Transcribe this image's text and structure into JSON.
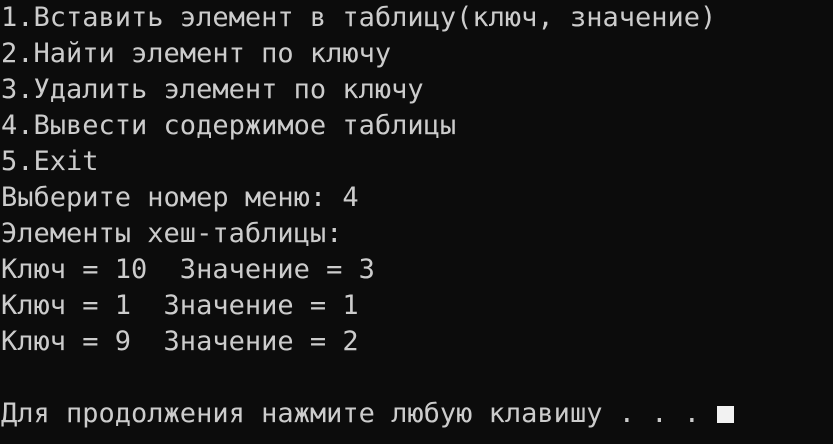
{
  "console": {
    "lines": [
      "1.Вставить элемент в таблицу(ключ, значение)",
      "2.Найти элемент по ключу",
      "3.Удалить элемент по ключу",
      "4.Вывести содержимое таблицы",
      "5.Exit",
      "Выберите номер меню: 4",
      "Элементы хеш-таблицы:",
      "Ключ = 10  Значение = 3",
      "Ключ = 1  Значение = 1",
      "Ключ = 9  Значение = 2",
      "",
      "Для продолжения нажмите любую клавишу . . . "
    ]
  },
  "colors": {
    "background": "#0c0c0c",
    "text": "#cccccc",
    "cursor": "#f2f2f2"
  }
}
